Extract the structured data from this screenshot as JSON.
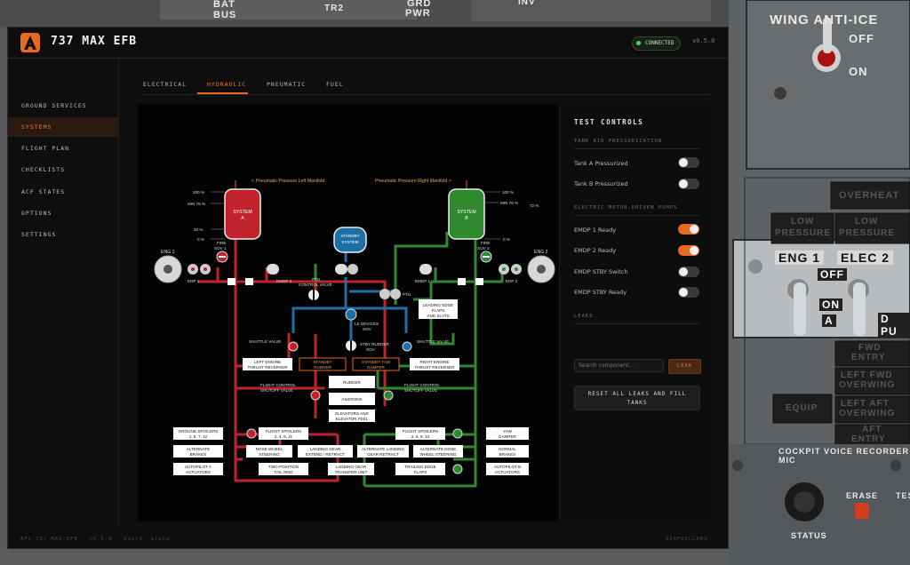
{
  "cockpit": {
    "top_labels": [
      "BAT",
      "BUS",
      "TR2",
      "GRD",
      "PWR",
      "INV"
    ],
    "wing_anti_ice": {
      "title": "WING ANTI-ICE",
      "off": "OFF",
      "on": "ON"
    },
    "overheat": "OVERHEAT",
    "low_pressure": [
      "LOW",
      "PRESSURE",
      "LOW",
      "PRESSURE"
    ],
    "eng1": "ENG 1",
    "elec2": "ELEC 2",
    "off": "OFF",
    "on": "ON",
    "a": "A",
    "pu": "D PU",
    "equip": "EQUIP",
    "fwd_entry": [
      "FWD",
      "ENTRY"
    ],
    "left_fwd_overwing": [
      "LEFT FWD",
      "OVERWING"
    ],
    "left_aft_overwing": [
      "LEFT AFT",
      "OVERWING"
    ],
    "aft_entry": [
      "AFT",
      "ENTRY"
    ],
    "cvr": "COCKPIT VOICE RECORDER MIC",
    "erase": "ERASE",
    "test": "TES",
    "status": "STATUS"
  },
  "app": {
    "title": "737 MAX EFB",
    "connection": "CONNECTED",
    "version": "v0.5.0"
  },
  "sidebar": {
    "items": [
      {
        "label": "GROUND SERVICES"
      },
      {
        "label": "SYSTEMS"
      },
      {
        "label": "FLIGHT PLAN"
      },
      {
        "label": "CHECKLISTS"
      },
      {
        "label": "ACF STATES"
      },
      {
        "label": "OPTIONS"
      },
      {
        "label": "SETTINGS"
      }
    ]
  },
  "tabs": [
    {
      "label": "ELECTRICAL"
    },
    {
      "label": "HYDRAULIC"
    },
    {
      "label": "PNEUMATIC"
    },
    {
      "label": "FUEL"
    }
  ],
  "diagram": {
    "pneu_left": "< Pneumatic Pressure Left Manifold",
    "pneu_right": "Pneumatic Pressure Right Manifold >",
    "sys_a": [
      "SYSTEM",
      "A"
    ],
    "sys_b": [
      "SYSTEM",
      "B"
    ],
    "standby": [
      "STANDBY",
      "SYSTEM"
    ],
    "pct100": "100 %",
    "min76": "MIN 76 %",
    "pct72": "72 %",
    "pct20": "20 %",
    "pct0": "0 %",
    "fire_sov1": [
      "FIRE",
      "SOV 1"
    ],
    "fire_sov2": [
      "FIRE",
      "SOV 2"
    ],
    "eng1": "ENG 1",
    "eng2": "ENG 2",
    "edp1": "EDP 1",
    "edp2": "EDP 2",
    "emdp1": "EMDP 1",
    "emdp2": "EMDP 2",
    "ptu_cv": [
      "PTU",
      "CONTROL VALVE"
    ],
    "ptu": "PTU",
    "le_flaps": [
      "LEADING EDGE",
      "FLAPS",
      "AND SLATS"
    ],
    "le_devices": [
      "LE DEVICES",
      "SOV"
    ],
    "stby_rudder": [
      "STBY RUDDER",
      "SOV"
    ],
    "shuttle": "SHUTTLE VALVE",
    "left_rev": [
      "LEFT ENGINE",
      "THRUST REVERSER"
    ],
    "right_rev": [
      "RIGHT ENGINE",
      "THRUST REVERSER"
    ],
    "stby_rudder_box": [
      "STANDBY",
      "RUDDER"
    ],
    "stby_yaw": [
      "STANDBY YAW",
      "DAMPER"
    ],
    "rudder": "RUDDER",
    "ailerons": "AILERONS",
    "elevators": [
      "ELEVATORS AND",
      "ELEVATOR FEEL"
    ],
    "fc_shutoff": [
      "FLIGHT CONTROL",
      "SHUTOFF VALVE"
    ],
    "ground_spoilers": [
      "GROUND SPOILERS",
      "1, 6, 7, 12"
    ],
    "flight_spoilers_a": [
      "FLIGHT SPOILERS",
      "2, 4, 9, 11"
    ],
    "flight_spoilers_b": [
      "FLIGHT SPOILERS",
      "3, 5, 8, 10"
    ],
    "yaw_damper": [
      "YAW",
      "DAMPER"
    ],
    "alt_brakes": [
      "ALTERNATE",
      "BRAKES"
    ],
    "nose_wheel": [
      "NOSE WHEEL",
      "STEERING"
    ],
    "lg_extend": [
      "LANDING GEAR",
      "EXTEND / RETRACT"
    ],
    "alt_lg": [
      "ALTERNATE LANDING",
      "GEAR RETRACT"
    ],
    "alt_nose": [
      "ALTERNATE NOSE",
      "WHEEL STEERING"
    ],
    "normal_brakes": [
      "NORMAL",
      "BRAKES"
    ],
    "autopilot_a": [
      "AUTOPILOT A",
      "ACTUATORS"
    ],
    "tail_skid": [
      "TWO-POSITION",
      "TAIL SKID"
    ],
    "lg_transfer": [
      "LANDING GEAR",
      "TRANSFER UNIT"
    ],
    "te_flaps": [
      "TRAILING EDGE",
      "FLAPS"
    ],
    "autopilot_b": [
      "AUTOPILOT B",
      "ACTUATORS"
    ]
  },
  "controls": {
    "title": "TEST CONTROLS",
    "sec_tank": "TANK AIR PRESSURIZATION",
    "tank_a": "Tank A Pressurized",
    "tank_a_on": false,
    "tank_b": "Tank B Pressurized",
    "tank_b_on": false,
    "sec_pumps": "ELECTRIC MOTOR-DRIVEN PUMPS",
    "emdp1": "EMDP 1 Ready",
    "emdp1_on": true,
    "emdp2": "EMDP 2 Ready",
    "emdp2_on": true,
    "stby_switch": "EMDP STBY Switch",
    "stby_switch_on": false,
    "stby_ready": "EMDP STBY Ready",
    "stby_ready_on": false,
    "sec_leaks": "LEAKS",
    "search_placeholder": "Search component...",
    "leak_button": "LEAK",
    "reset_line1": "RESET ALL LEAKS AND FILL",
    "reset_line2": "TANKS"
  },
  "footer": {
    "left": "AFL 737 MAX EFB · v0.5.0 · build: alpha",
    "right": "AIRFOILLABS"
  },
  "colors": {
    "accent": "#e86a1f",
    "sys_a": "#c0242a",
    "sys_b": "#2f8a2f",
    "standby": "#1d6fa5",
    "connected": "#3ddc5a"
  }
}
